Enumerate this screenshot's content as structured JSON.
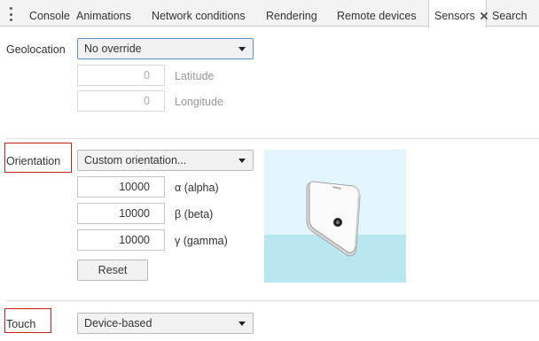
{
  "tabs": [
    {
      "label": "Console"
    },
    {
      "label": "Animations"
    },
    {
      "label": "Network conditions"
    },
    {
      "label": "Rendering"
    },
    {
      "label": "Remote devices"
    },
    {
      "label": "Sensors"
    },
    {
      "label": "Search"
    }
  ],
  "active_tab": "Sensors",
  "geolocation": {
    "label": "Geolocation",
    "select_value": "No override",
    "latitude_value": "0",
    "latitude_label": "Latitude",
    "longitude_value": "0",
    "longitude_label": "Longitude"
  },
  "orientation": {
    "label": "Orientation",
    "select_value": "Custom orientation...",
    "alpha_value": "10000",
    "alpha_label": "α (alpha)",
    "beta_value": "10000",
    "beta_label": "β (beta)",
    "gamma_value": "10000",
    "gamma_label": "γ (gamma)",
    "reset_label": "Reset"
  },
  "touch": {
    "label": "Touch",
    "select_value": "Device-based"
  },
  "colors": {
    "highlight_box": "#cc1d1d",
    "focus_border": "#5c8fcf",
    "preview_sky": "#e3f5fc",
    "preview_floor": "#b8e7ef"
  }
}
